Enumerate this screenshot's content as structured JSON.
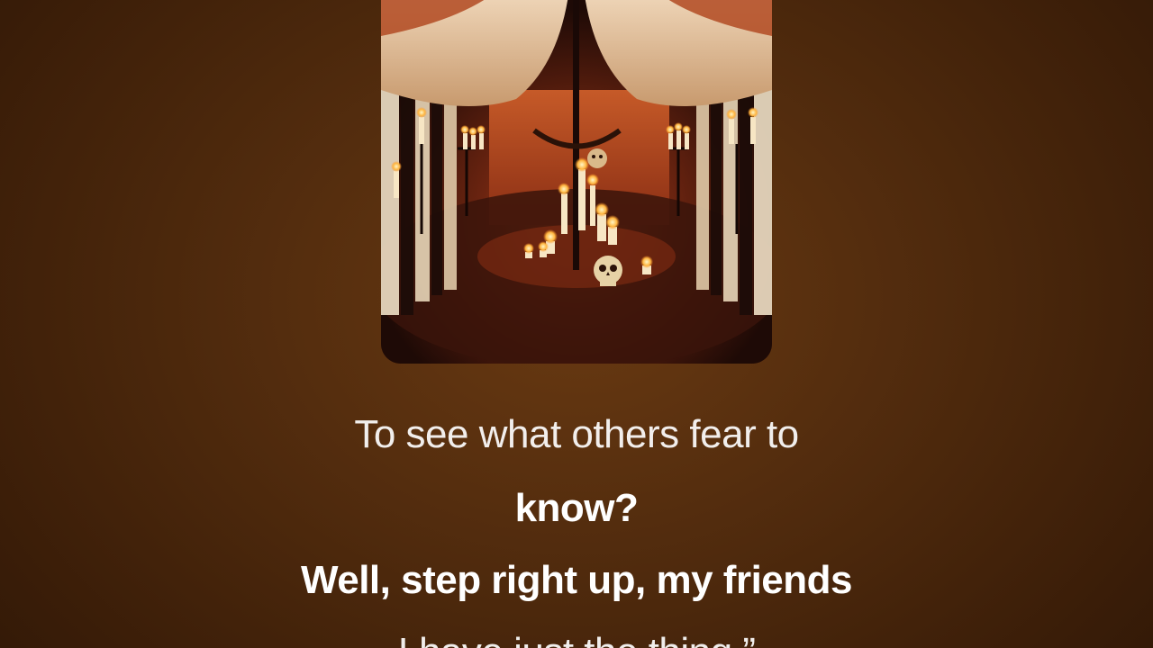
{
  "player": {
    "artwork": "circus-tent-candles-skull-artwork"
  },
  "lyrics": {
    "lines": [
      {
        "text": "To see what others fear to",
        "state": "past"
      },
      {
        "text": "know?",
        "state": "active"
      },
      {
        "text": "Well, step right up, my friends",
        "state": "active"
      },
      {
        "text": "I have just the thing.”",
        "state": "upcoming"
      }
    ]
  },
  "colors": {
    "background": "#4f2a0d",
    "text": "#ffffff"
  }
}
